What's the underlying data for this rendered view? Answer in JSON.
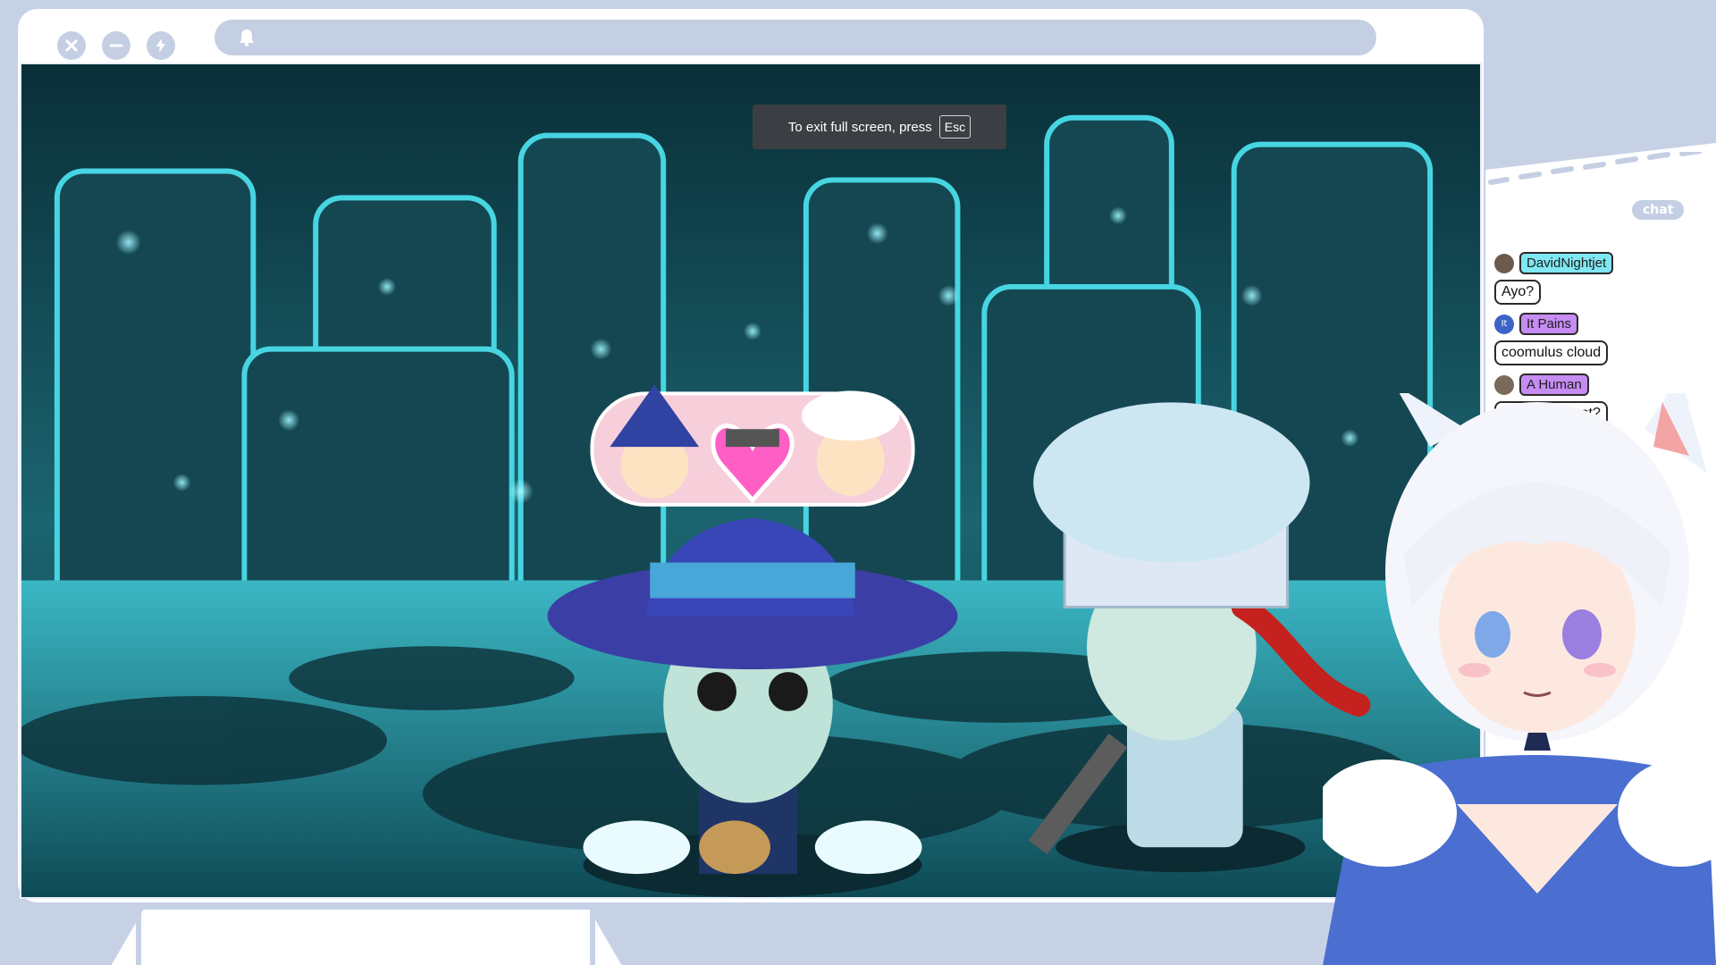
{
  "window": {
    "controls": [
      {
        "name": "close",
        "icon": "close-icon"
      },
      {
        "name": "minimize",
        "icon": "minus-icon"
      },
      {
        "name": "lightning",
        "icon": "lightning-icon"
      }
    ],
    "address_icon": "bell-icon"
  },
  "fullscreen_toast": {
    "text": "To exit full screen, press",
    "key": "Esc"
  },
  "chat": {
    "title": "chat",
    "messages": [
      {
        "user": "DavidNightjet",
        "text": "Ayo?",
        "name_color": "#7ee7f2",
        "avatar_text": ""
      },
      {
        "user": "It Pains",
        "text": "coomulus cloud",
        "name_color": "#c58cf2",
        "avatar_text": "It"
      },
      {
        "user": "A Human",
        "text": "Would you not?",
        "name_color": "#c58cf2",
        "avatar_text": ""
      }
    ]
  },
  "colors": {
    "frame": "#c6d1e6",
    "game_bg": "#0f3d46",
    "heart": "#ff5fc5"
  }
}
